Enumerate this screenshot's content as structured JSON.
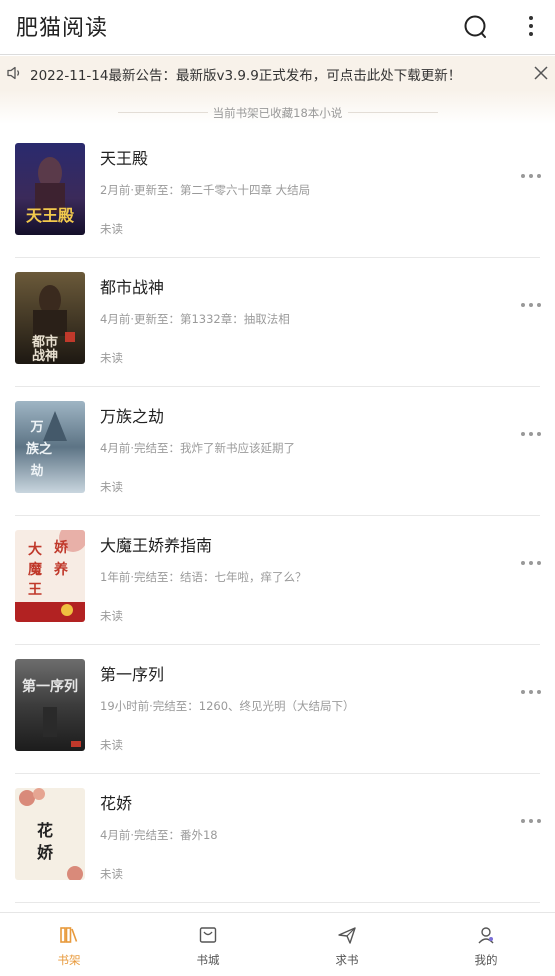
{
  "app": {
    "title": "肥猫阅读"
  },
  "header": {
    "search_icon": "search-icon",
    "more_icon": "more-vertical-icon"
  },
  "notice": {
    "icon": "speaker-icon",
    "text": "2022-11-14最新公告：最新版v3.9.9正式发布，可点击此处下载更新！",
    "close_icon": "close-icon"
  },
  "shelf": {
    "collected_text": "当前书架已收藏18本小说"
  },
  "books": [
    {
      "title": "天王殿",
      "meta": "2月前·更新至：第二千零六十四章 大结局",
      "status": "未读",
      "cover_text": "天王殿"
    },
    {
      "title": "都市战神",
      "meta": "4月前·更新至：第1332章：抽取法相",
      "status": "未读",
      "cover_text": "都市战神"
    },
    {
      "title": "万族之劫",
      "meta": "4月前·完结至：我炸了新书应该延期了",
      "status": "未读",
      "cover_text": "万族之劫"
    },
    {
      "title": "大魔王娇养指南",
      "meta": "1年前·完结至：结语：七年啦，痒了么？",
      "status": "未读",
      "cover_text": "大魔王娇养"
    },
    {
      "title": "第一序列",
      "meta": "19小时前·完结至：1260、终见光明（大结局下）",
      "status": "未读",
      "cover_text": "第一序列"
    },
    {
      "title": "花娇",
      "meta": "4月前·完结至：番外18",
      "status": "未读",
      "cover_text": "花娇"
    }
  ],
  "bottom_nav": [
    {
      "label": "书架",
      "icon": "bookshelf-icon",
      "active": true
    },
    {
      "label": "书城",
      "icon": "store-icon",
      "active": false
    },
    {
      "label": "求书",
      "icon": "paper-plane-icon",
      "active": false
    },
    {
      "label": "我的",
      "icon": "user-icon",
      "active": false
    }
  ],
  "colors": {
    "accent": "#e89a3c",
    "notice_bg": "#f8f2ea",
    "muted_text": "#9a9a9a"
  }
}
